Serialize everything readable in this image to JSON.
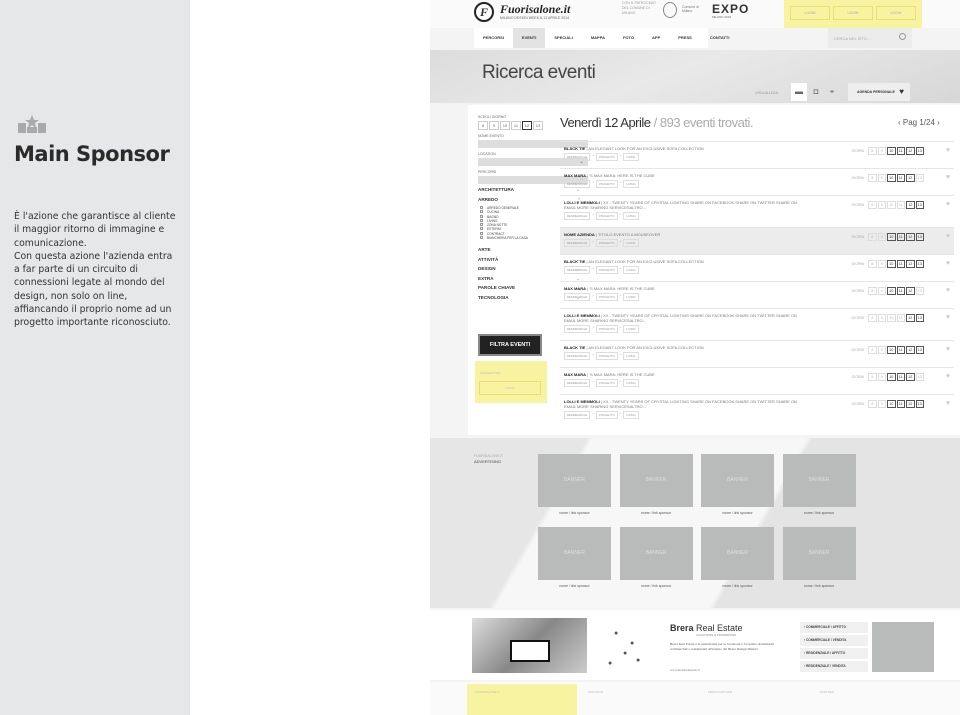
{
  "sponsor": {
    "title": "Main Sponsor",
    "icon": "podium-star-icon",
    "paragraph1": "È l'azione che garantisce al cliente il maggior ritorno di immagine e comunicazione.",
    "paragraph2": "Con questa azione l'azienda entra a far parte di un circuito di connessioni legate al mondo del design, non solo on line, affiancando il proprio nome ad  un progetto importante riconosciuto."
  },
  "header": {
    "logo": "Fuorisalone.it",
    "logo_letter": "F",
    "logo_sub": "MILANO DESIGN WEEK 8-13 APRILE 2014",
    "comune": "CON IL PATROCINIO DEL COMUNE DI MILANO",
    "comune2": "Comune di Milano",
    "expo": "EXPO",
    "expo_sub": "MILANO 2015",
    "yellow_buttons": [
      "LOGIN",
      "LOGIN",
      "LOGIN"
    ]
  },
  "nav": {
    "items": [
      "PERCORSI",
      "EVENTI",
      "SPECIALI",
      "MAPPA",
      "FOTO",
      "APP",
      "PRESS",
      "CONTATTI"
    ],
    "active": "EVENTI",
    "search_placeholder": "CERCA NEL SITO..."
  },
  "hero": {
    "title": "Ricerca eventi",
    "visualizza": "VISUALIZZA:",
    "view_icons": [
      "list-icon",
      "camera-icon",
      "map-pin-icon"
    ],
    "agenda": "AGENDA PERSONALE"
  },
  "filters": {
    "days_label": "SCEGLI GIORNO",
    "days": [
      "8",
      "9",
      "10",
      "11",
      "12",
      "13"
    ],
    "selected_day": "12",
    "nome_evento": "NOME EVENTO",
    "location": "LOCATION",
    "percorsi": "PERCORSI",
    "categories_top": [
      "ARCHITETTURA",
      "ARREDO"
    ],
    "arredo_sub": [
      "ARREDO GENERALE",
      "CUCINA",
      "BAGNO",
      "LIVING",
      "ZONA NOTTE",
      "ESTERNI",
      "CONTRACT",
      "BIANCHERIA PER LA CASA"
    ],
    "categories_bottom": [
      "ARTE",
      "ATTIVITÀ",
      "DESIGN",
      "EXTRA",
      "PAROLE CHIAVE",
      "TECNOLOGIA"
    ],
    "filter_button": "FILTRA EVENTI",
    "yellow_label": "NEWSLETTER",
    "yellow_button": "LOGO"
  },
  "results": {
    "date": "Venerdì 12 Aprile",
    "count": "/ 893 eventi trovati.",
    "page": "Pag 1/24",
    "giorni_label": "GIORNI",
    "events": [
      {
        "name": "BLACK TIE",
        "desc": "| AN ELEGANT LOOK FOR AN EXCLUSIVE SOFA COLLECTION",
        "on": [
          "10",
          "11",
          "12",
          "13"
        ]
      },
      {
        "name": "MAX MARA",
        "desc": "| 'S MAX MARA: HERE IS THE CUBE",
        "on": [
          "10",
          "11",
          "12"
        ]
      },
      {
        "name": "LOLLI E MEMMOLI",
        "desc": "| XX - TWENTY YEARS OF CRYSTAL LIGHTING SHARE ON FACEBOOK SHARE ON TWITTER SHARE ON EMAIL MORE SHARING SERVICESALTRO...",
        "on": [
          "12",
          "13"
        ]
      },
      {
        "name": "NOME AZIENDA",
        "desc": "| TITOLO EVENTO A MOUSEOVER",
        "on": [
          "10",
          "11",
          "12",
          "13"
        ],
        "highlight": true
      },
      {
        "name": "BLACK TIE",
        "desc": "| AN ELEGANT LOOK FOR AN EXCLUSIVE SOFA COLLECTION",
        "on": [
          "10",
          "11",
          "12",
          "13"
        ]
      },
      {
        "name": "MAX MARA",
        "desc": "| 'S MAX MARA: HERE IS THE CUBE",
        "on": [
          "10",
          "11",
          "12"
        ]
      },
      {
        "name": "LOLLI E MEMMOLI",
        "desc": "| XX - TWENTY YEARS OF CRYSTAL LIGHTING SHARE ON FACEBOOK SHARE ON TWITTER SHARE ON EMAIL MORE SHARING SERVICESALTRO...",
        "on": [
          "12",
          "13"
        ]
      },
      {
        "name": "BLACK TIE",
        "desc": "| AN ELEGANT LOOK FOR AN EXCLUSIVE SOFA COLLECTION",
        "on": [
          "10",
          "11",
          "12",
          "13"
        ]
      },
      {
        "name": "MAX MARA",
        "desc": "| 'S MAX MARA: HERE IS THE CUBE",
        "on": [
          "10",
          "11",
          "12"
        ]
      },
      {
        "name": "LOLLI E MEMMOLI",
        "desc": "| XX - TWENTY YEARS OF CRYSTAL LIGHTING SHARE ON FACEBOOK SHARE ON TWITTER SHARE ON EMAIL MORE SHARING SERVICESALTRO...",
        "on": [
          "10",
          "11",
          "12",
          "13"
        ]
      }
    ],
    "tags": [
      "RESIDENZIALE",
      "PROGETTO",
      "LIVING"
    ]
  },
  "ads": {
    "label1": "FUORISALONE.IT",
    "label2": "ADVERTISING",
    "banner": "BANNER",
    "caption": "nome / link sponsor"
  },
  "brera": {
    "logo_bold": "Brera",
    "logo_rest": " Real Estate",
    "sub": "LOCATIONS & PROPERTIES",
    "desc": "Brera Real Estate è la piattaforma per la locazione e l'acquisto di immobili commerciali o residenziali all'interno del Brera Design District.",
    "url": "www.brerarealestate.it",
    "links": [
      "› COMMERCIALE / AFFITTO",
      "› COMMERCIALE / VENDITA",
      "› RESIDENZIALE / AFFITTO",
      "› RESIDENZIALE / VENDITA"
    ]
  },
  "footer": {
    "cols": [
      "FUORISALONE.IT",
      "SPONSOR",
      "MEDIA PARTNER",
      "PARTNER"
    ]
  },
  "colors": {
    "highlight_yellow": "#f8f3a0",
    "panel_gray": "#e6e7e9",
    "banner_gray": "#b9bbba"
  }
}
